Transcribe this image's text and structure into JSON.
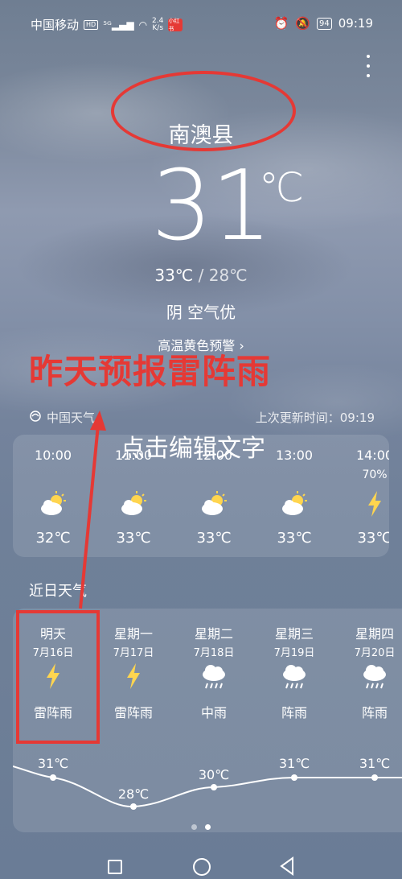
{
  "status_bar": {
    "carrier": "中国移动",
    "hd": "HD",
    "network": "5G",
    "speed_top": "2.4",
    "speed_bottom": "K/s",
    "battery": "94",
    "time": "09:19"
  },
  "weather": {
    "city": "南澳县",
    "temp": "31",
    "unit": "℃",
    "high": "33℃",
    "separator": " / ",
    "low": "28℃",
    "condition": "阴  空气优",
    "alert": "高温黄色预警 ›",
    "source": "中国天气",
    "updated": "上次更新时间：09:19"
  },
  "annotations": {
    "big_text": "昨天预报雷阵雨",
    "overlay_text": "点击编辑文字",
    "annotation_color": "#e53935"
  },
  "hourly": [
    {
      "time": "10:00",
      "precip": "",
      "icon": "partly-cloudy-icon",
      "temp": "32℃"
    },
    {
      "time": "11:00",
      "precip": "",
      "icon": "partly-cloudy-icon",
      "temp": "33℃"
    },
    {
      "time": "12:00",
      "precip": "",
      "icon": "partly-cloudy-icon",
      "temp": "33℃"
    },
    {
      "time": "13:00",
      "precip": "",
      "icon": "partly-cloudy-icon",
      "temp": "33℃"
    },
    {
      "time": "14:00",
      "precip": "70%",
      "icon": "lightning-icon",
      "temp": "33℃"
    }
  ],
  "daily_title": "近日天气",
  "daily": [
    {
      "name": "明天",
      "date": "7月16日",
      "icon": "lightning-icon",
      "cond": "雷阵雨",
      "high": "31℃",
      "low": ""
    },
    {
      "name": "星期一",
      "date": "7月17日",
      "icon": "lightning-icon",
      "cond": "雷阵雨",
      "high": "",
      "low": "28℃"
    },
    {
      "name": "星期二",
      "date": "7月18日",
      "icon": "rain-icon",
      "cond": "中雨",
      "high": "30℃",
      "low": ""
    },
    {
      "name": "星期三",
      "date": "7月19日",
      "icon": "rain-icon",
      "cond": "阵雨",
      "high": "31℃",
      "low": ""
    },
    {
      "name": "星期四",
      "date": "7月20日",
      "icon": "rain-icon",
      "cond": "阵雨",
      "high": "31℃",
      "low": ""
    }
  ],
  "page_indicator": {
    "count": 2,
    "active": 1
  }
}
